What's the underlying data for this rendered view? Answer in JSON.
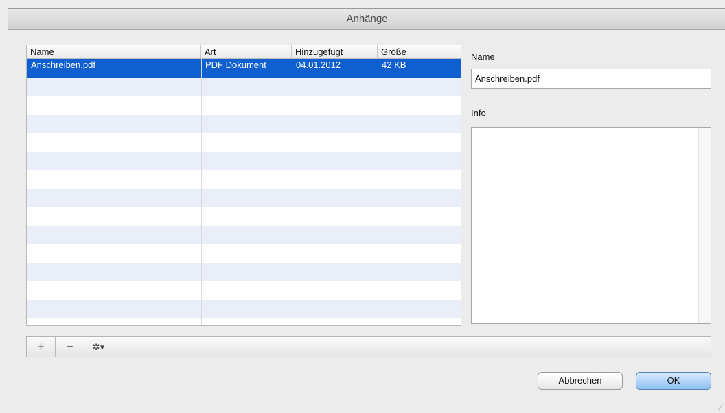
{
  "window": {
    "title": "Anhänge"
  },
  "table": {
    "columns": [
      "Name",
      "Art",
      "Hinzugefügt",
      "Größe"
    ],
    "rows": [
      {
        "name": "Anschreiben.pdf",
        "type": "PDF Dokument",
        "added": "04.01.2012",
        "size": "42 KB",
        "selected": true
      }
    ]
  },
  "toolbar": {
    "add_label": "+",
    "remove_label": "−",
    "actions_label": "✲▾"
  },
  "details": {
    "name_label": "Name",
    "name_value": "Anschreiben.pdf",
    "info_label": "Info",
    "info_value": ""
  },
  "buttons": {
    "cancel_label": "Abbrechen",
    "ok_label": "OK"
  },
  "colors": {
    "selection": "#0f5fd1",
    "stripe": "#e9eef8",
    "primary_button": "#8fbff2"
  },
  "icons": [
    "plus-icon",
    "minus-icon",
    "gear-icon",
    "resize-grip-icon"
  ]
}
